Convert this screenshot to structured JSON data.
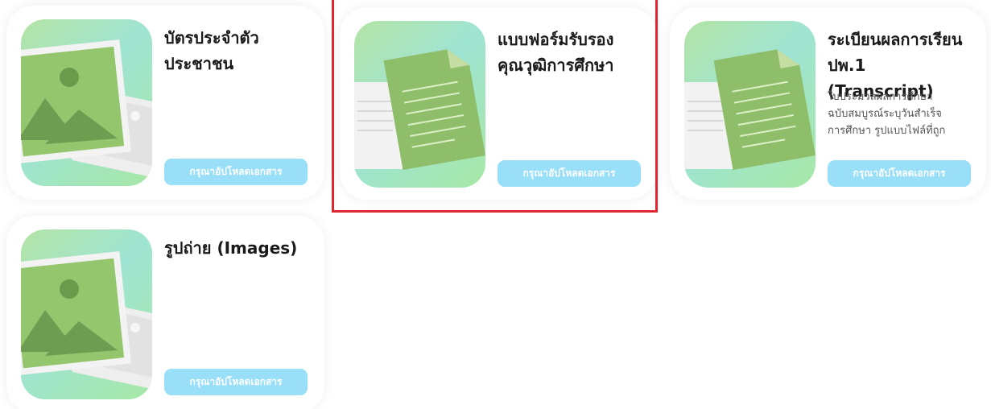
{
  "cards": [
    {
      "title": "บัตรประจำตัว\nประชาชน",
      "description": "",
      "button_label": "กรุณาอัปโหลดเอกสาร",
      "icon": "image-icon"
    },
    {
      "title": "แบบฟอร์มรับรอง\nคุณวุฒิการศึกษา",
      "description": "",
      "button_label": "กรุณาอัปโหลดเอกสาร",
      "icon": "document-icon"
    },
    {
      "title": "ระเบียนผลการเรียน\nปพ.1 (Transcript)",
      "description": "ใบประมวลผลการศึกษา\nฉบับสมบูรณ์ระบุวันสำเร็จ\nการศึกษา รูปแบบไฟล์ที่ถูก",
      "button_label": "กรุณาอัปโหลดเอกสาร",
      "icon": "document-icon"
    },
    {
      "title": "รูปถ่าย (Images)",
      "description": "",
      "button_label": "กรุณาอัปโหลดเอกสาร",
      "icon": "image-icon"
    }
  ],
  "colors": {
    "button_bg": "#99dff8",
    "highlight_border": "#e0262f",
    "thumb_gradient": [
      "#b4e4a5",
      "#9fe4d3"
    ],
    "doc_green": "#8fbe6a"
  }
}
